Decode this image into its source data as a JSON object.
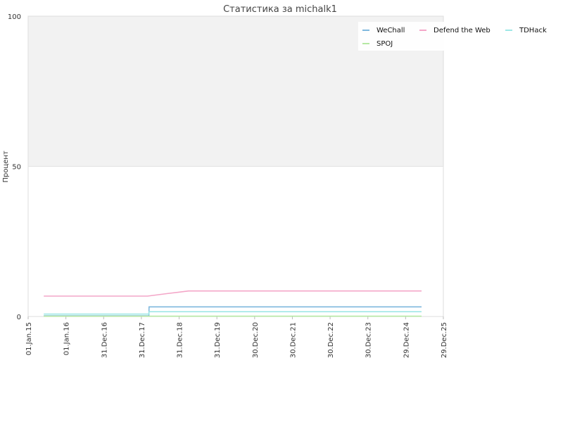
{
  "chart_data": {
    "type": "line",
    "title": "Статистика за michalk1",
    "ylabel": "Процент",
    "xlabel": "",
    "ylim": [
      0,
      100
    ],
    "y_ticks": [
      "0",
      "50",
      "100"
    ],
    "x_ticks": [
      "01.Jan.15",
      "01.Jan.16",
      "31.Dec.16",
      "31.Dec.17",
      "31.Dec.18",
      "31.Dec.19",
      "30.Dec.20",
      "30.Dec.21",
      "30.Dec.22",
      "30.Dec.23",
      "29.Dec.24",
      "29.Dec.25"
    ],
    "xlim": [
      "2015-01-01",
      "2025-12-29"
    ],
    "grid": true,
    "legend_position": "top-right",
    "series": [
      {
        "name": "WeChall",
        "color": "#7fb8de",
        "points": [
          [
            "2015-06-01",
            0.2
          ],
          [
            "2018-03-14",
            0.2
          ],
          [
            "2018-03-15",
            3.2
          ],
          [
            "2025-06-01",
            3.2
          ]
        ]
      },
      {
        "name": "Defend the Web",
        "color": "#f4a6c8",
        "points": [
          [
            "2015-06-01",
            6.8
          ],
          [
            "2018-03-01",
            6.8
          ],
          [
            "2018-09-01",
            7.6
          ],
          [
            "2019-04-01",
            8.5
          ],
          [
            "2025-06-01",
            8.5
          ]
        ]
      },
      {
        "name": "TDHack",
        "color": "#9ee7e6",
        "points": [
          [
            "2015-06-01",
            0.8
          ],
          [
            "2018-03-14",
            0.8
          ],
          [
            "2018-03-15",
            1.6
          ],
          [
            "2025-06-01",
            1.6
          ]
        ]
      },
      {
        "name": "SPOJ",
        "color": "#b5e8a3",
        "points": [
          [
            "2015-06-01",
            0.1
          ],
          [
            "2025-06-01",
            0.1
          ]
        ]
      }
    ]
  }
}
